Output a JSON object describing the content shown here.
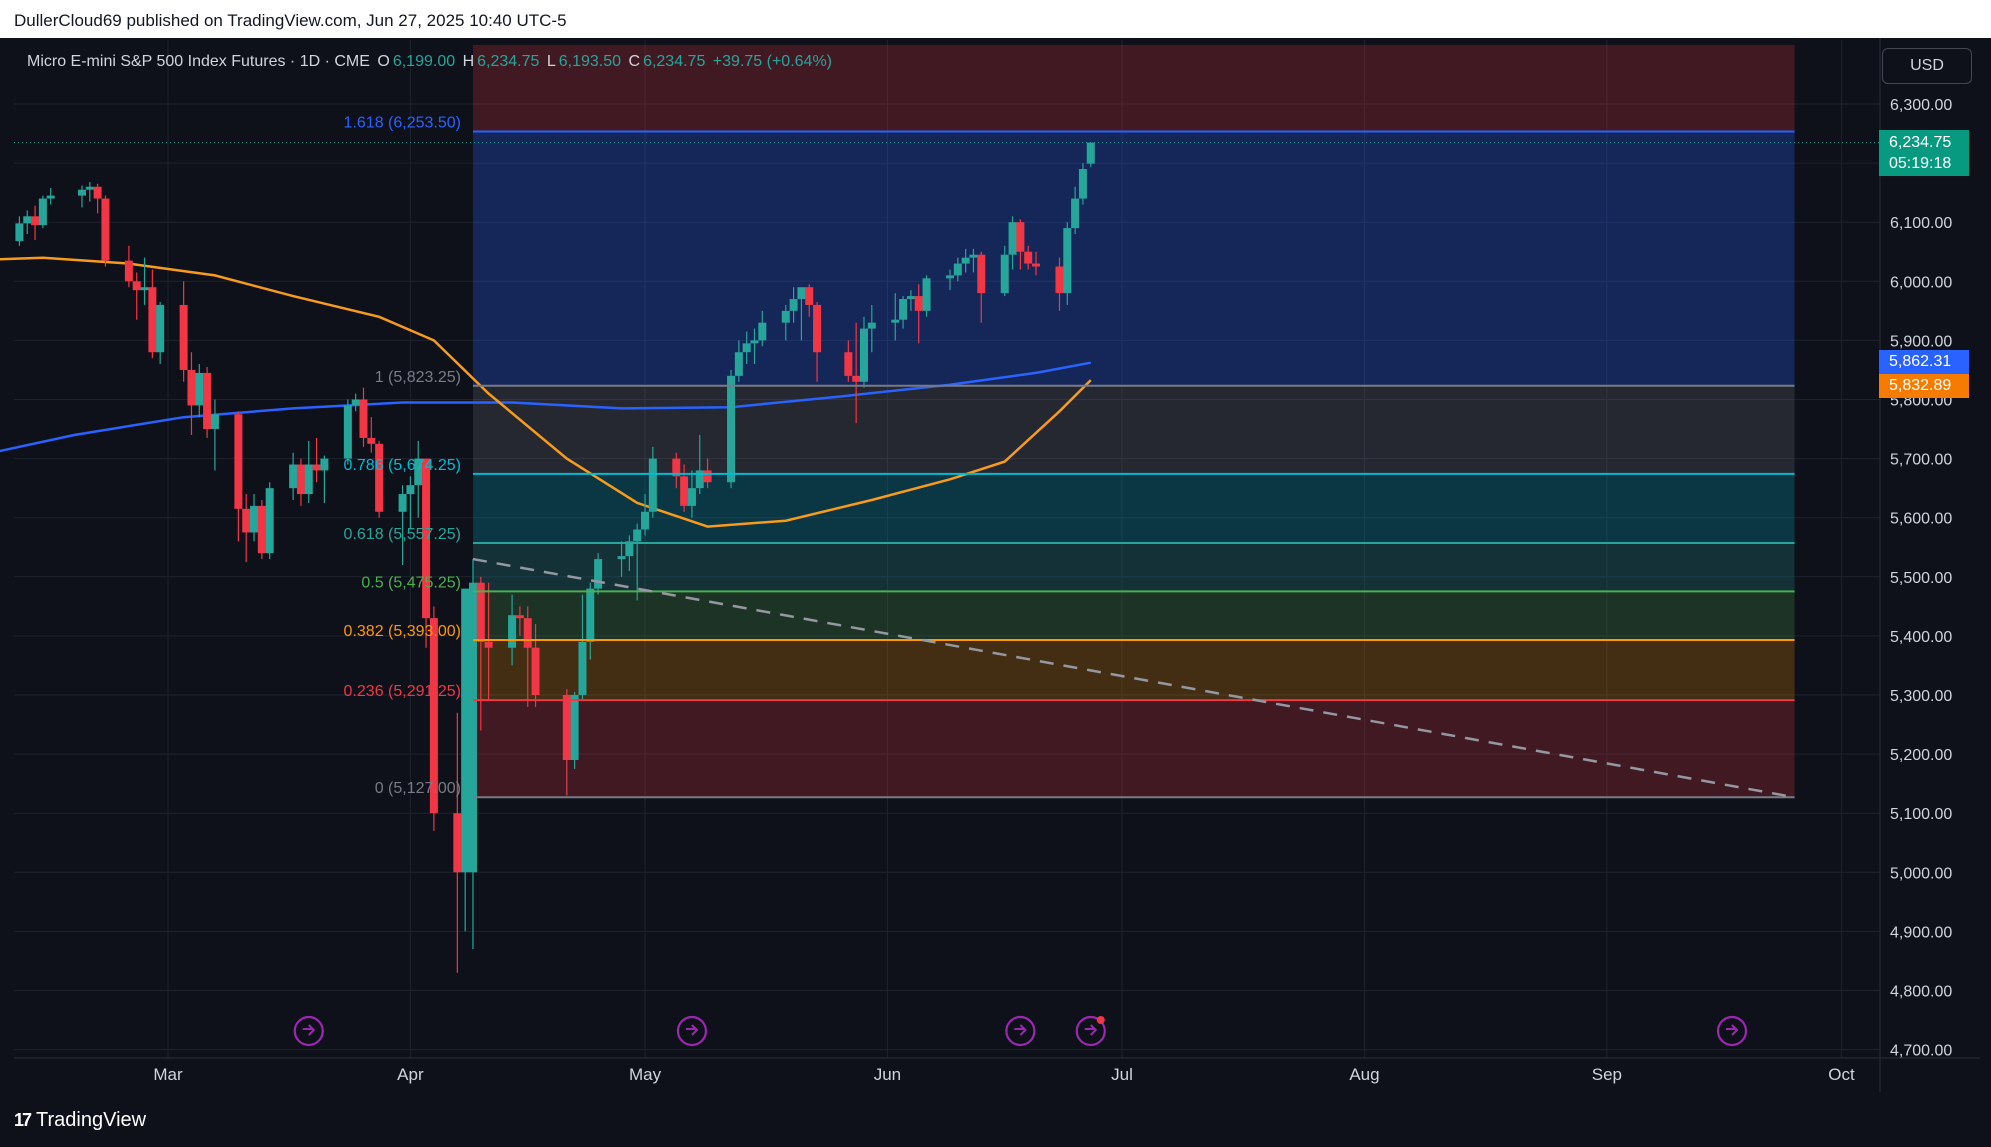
{
  "header": {
    "publisher": "DullerCloud69 published on TradingView.com, Jun 27, 2025 10:40 UTC-5"
  },
  "legend": {
    "symbol": "Micro E-mini S&P 500 Index Futures · 1D · CME",
    "o_label": "O",
    "o_value": "6,199.00",
    "h_label": "H",
    "h_value": "6,234.75",
    "l_label": "L",
    "l_value": "6,193.50",
    "c_label": "C",
    "c_value": "6,234.75",
    "change": "+39.75 (+0.64%)"
  },
  "currency": "USD",
  "price_tags": {
    "last_price": "6,234.75",
    "countdown": "05:19:18",
    "ma_blue": "5,862.31",
    "ma_orange": "5,832.89"
  },
  "footer": {
    "brand": "TradingView"
  },
  "colors": {
    "up": "#26a69a",
    "down": "#f23645",
    "ma_blue": "#2962ff",
    "ma_orange": "#f89b1c",
    "background": "#0f111a"
  },
  "chart_data": {
    "type": "candlestick",
    "ylim": [
      4650,
      6400
    ],
    "y_ticks": [
      "6,300.00",
      "6,200.00",
      "6,100.00",
      "6,000.00",
      "5,900.00",
      "5,800.00",
      "5,700.00",
      "5,600.00",
      "5,500.00",
      "5,400.00",
      "5,300.00",
      "5,200.00",
      "5,100.00",
      "5,000.00",
      "4,900.00",
      "4,800.00",
      "4,700.00"
    ],
    "x_ticks": [
      "Mar",
      "Apr",
      "May",
      "Jun",
      "Jul",
      "Aug",
      "Sep",
      "Oct"
    ],
    "x_tick_dates": [
      "2025-03-01",
      "2025-04-01",
      "2025-05-01",
      "2025-06-01",
      "2025-07-01",
      "2025-08-01",
      "2025-09-01",
      "2025-10-01"
    ],
    "fib_levels": [
      {
        "label": "1.618 (6,253.50)",
        "value": 6253.5,
        "color": "#2962ff"
      },
      {
        "label": "1 (5,823.25)",
        "value": 5823.25,
        "color": "#787b86"
      },
      {
        "label": "0.786 (5,674.25)",
        "value": 5674.25,
        "color": "#00bcd4"
      },
      {
        "label": "0.618 (5,557.25)",
        "value": 5557.25,
        "color": "#26a69a"
      },
      {
        "label": "0.5 (5,475.25)",
        "value": 5475.25,
        "color": "#4caf50"
      },
      {
        "label": "0.382 (5,393.00)",
        "value": 5393.0,
        "color": "#ff9800"
      },
      {
        "label": "0.236 (5,291.25)",
        "value": 5291.25,
        "color": "#f23645"
      },
      {
        "label": "0 (5,127.00)",
        "value": 5127.0,
        "color": "#787b86"
      }
    ],
    "fib_range_dates": [
      "2025-04-09",
      "2025-09-25"
    ],
    "fib_top_value": 6400,
    "trendline": {
      "from": {
        "date": "2025-04-09",
        "value": 5530
      },
      "to": {
        "date": "2025-09-25",
        "value": 5127
      }
    },
    "event_icon_dates": [
      "2025-03-19",
      "2025-05-07",
      "2025-06-18",
      "2025-06-27",
      "2025-09-17"
    ],
    "candles": [
      {
        "d": "2025-02-03",
        "o": 6060,
        "h": 6098,
        "l": 6040,
        "c": 6082
      },
      {
        "d": "2025-02-04",
        "o": 6082,
        "h": 6110,
        "l": 6070,
        "c": 6090
      },
      {
        "d": "2025-02-05",
        "o": 6090,
        "h": 6112,
        "l": 6065,
        "c": 6098
      },
      {
        "d": "2025-02-06",
        "o": 6098,
        "h": 6125,
        "l": 6090,
        "c": 6118
      },
      {
        "d": "2025-02-07",
        "o": 6118,
        "h": 6130,
        "l": 6060,
        "c": 6068
      },
      {
        "d": "2025-02-10",
        "o": 6068,
        "h": 6110,
        "l": 6060,
        "c": 6098
      },
      {
        "d": "2025-02-11",
        "o": 6098,
        "h": 6120,
        "l": 6080,
        "c": 6110
      },
      {
        "d": "2025-02-12",
        "o": 6110,
        "h": 6128,
        "l": 6070,
        "c": 6095
      },
      {
        "d": "2025-02-13",
        "o": 6095,
        "h": 6145,
        "l": 6090,
        "c": 6140
      },
      {
        "d": "2025-02-14",
        "o": 6140,
        "h": 6158,
        "l": 6130,
        "c": 6145
      },
      {
        "d": "2025-02-18",
        "o": 6145,
        "h": 6162,
        "l": 6125,
        "c": 6155
      },
      {
        "d": "2025-02-19",
        "o": 6155,
        "h": 6168,
        "l": 6135,
        "c": 6160
      },
      {
        "d": "2025-02-20",
        "o": 6160,
        "h": 6165,
        "l": 6115,
        "c": 6140
      },
      {
        "d": "2025-02-21",
        "o": 6140,
        "h": 6145,
        "l": 6025,
        "c": 6035
      },
      {
        "d": "2025-02-24",
        "o": 6035,
        "h": 6060,
        "l": 5990,
        "c": 6000
      },
      {
        "d": "2025-02-25",
        "o": 6000,
        "h": 6015,
        "l": 5935,
        "c": 5985
      },
      {
        "d": "2025-02-26",
        "o": 5985,
        "h": 6040,
        "l": 5960,
        "c": 5990
      },
      {
        "d": "2025-02-27",
        "o": 5990,
        "h": 6020,
        "l": 5870,
        "c": 5880
      },
      {
        "d": "2025-02-28",
        "o": 5880,
        "h": 5965,
        "l": 5860,
        "c": 5960
      },
      {
        "d": "2025-03-03",
        "o": 5960,
        "h": 6000,
        "l": 5830,
        "c": 5850
      },
      {
        "d": "2025-03-04",
        "o": 5850,
        "h": 5880,
        "l": 5740,
        "c": 5790
      },
      {
        "d": "2025-03-05",
        "o": 5790,
        "h": 5860,
        "l": 5770,
        "c": 5845
      },
      {
        "d": "2025-03-06",
        "o": 5845,
        "h": 5855,
        "l": 5735,
        "c": 5750
      },
      {
        "d": "2025-03-07",
        "o": 5750,
        "h": 5800,
        "l": 5680,
        "c": 5775
      },
      {
        "d": "2025-03-10",
        "o": 5775,
        "h": 5780,
        "l": 5560,
        "c": 5615
      },
      {
        "d": "2025-03-11",
        "o": 5615,
        "h": 5640,
        "l": 5525,
        "c": 5575
      },
      {
        "d": "2025-03-12",
        "o": 5575,
        "h": 5640,
        "l": 5560,
        "c": 5620
      },
      {
        "d": "2025-03-13",
        "o": 5620,
        "h": 5630,
        "l": 5530,
        "c": 5540
      },
      {
        "d": "2025-03-14",
        "o": 5540,
        "h": 5660,
        "l": 5530,
        "c": 5650
      },
      {
        "d": "2025-03-17",
        "o": 5650,
        "h": 5710,
        "l": 5630,
        "c": 5690
      },
      {
        "d": "2025-03-18",
        "o": 5690,
        "h": 5700,
        "l": 5620,
        "c": 5640
      },
      {
        "d": "2025-03-19",
        "o": 5640,
        "h": 5730,
        "l": 5625,
        "c": 5690
      },
      {
        "d": "2025-03-20",
        "o": 5690,
        "h": 5735,
        "l": 5660,
        "c": 5680
      },
      {
        "d": "2025-03-21",
        "o": 5680,
        "h": 5705,
        "l": 5625,
        "c": 5700
      },
      {
        "d": "2025-03-24",
        "o": 5700,
        "h": 5800,
        "l": 5690,
        "c": 5790
      },
      {
        "d": "2025-03-25",
        "o": 5790,
        "h": 5810,
        "l": 5780,
        "c": 5800
      },
      {
        "d": "2025-03-26",
        "o": 5800,
        "h": 5820,
        "l": 5720,
        "c": 5735
      },
      {
        "d": "2025-03-27",
        "o": 5735,
        "h": 5770,
        "l": 5710,
        "c": 5725
      },
      {
        "d": "2025-03-28",
        "o": 5725,
        "h": 5730,
        "l": 5600,
        "c": 5610
      },
      {
        "d": "2025-03-31",
        "o": 5610,
        "h": 5655,
        "l": 5520,
        "c": 5640
      },
      {
        "d": "2025-04-01",
        "o": 5640,
        "h": 5670,
        "l": 5580,
        "c": 5655
      },
      {
        "d": "2025-04-02",
        "o": 5655,
        "h": 5730,
        "l": 5600,
        "c": 5700
      },
      {
        "d": "2025-04-03",
        "o": 5700,
        "h": 5700,
        "l": 5380,
        "c": 5430
      },
      {
        "d": "2025-04-04",
        "o": 5430,
        "h": 5450,
        "l": 5070,
        "c": 5100
      },
      {
        "d": "2025-04-07",
        "o": 5100,
        "h": 5270,
        "l": 4830,
        "c": 5000
      },
      {
        "d": "2025-04-08",
        "o": 5000,
        "h": 5350,
        "l": 4900,
        "c": 5480
      },
      {
        "d": "2025-04-09",
        "o": 5000,
        "h": 5530,
        "l": 4870,
        "c": 5490
      },
      {
        "d": "2025-04-10",
        "o": 5490,
        "h": 5500,
        "l": 5240,
        "c": 5390
      },
      {
        "d": "2025-04-11",
        "o": 5390,
        "h": 5490,
        "l": 5290,
        "c": 5380
      },
      {
        "d": "2025-04-14",
        "o": 5380,
        "h": 5470,
        "l": 5350,
        "c": 5435
      },
      {
        "d": "2025-04-15",
        "o": 5435,
        "h": 5450,
        "l": 5400,
        "c": 5430
      },
      {
        "d": "2025-04-16",
        "o": 5430,
        "h": 5450,
        "l": 5280,
        "c": 5380
      },
      {
        "d": "2025-04-17",
        "o": 5380,
        "h": 5420,
        "l": 5280,
        "c": 5300
      },
      {
        "d": "2025-04-21",
        "o": 5300,
        "h": 5310,
        "l": 5130,
        "c": 5190
      },
      {
        "d": "2025-04-22",
        "o": 5190,
        "h": 5305,
        "l": 5175,
        "c": 5300
      },
      {
        "d": "2025-04-23",
        "o": 5300,
        "h": 5470,
        "l": 5290,
        "c": 5390
      },
      {
        "d": "2025-04-24",
        "o": 5390,
        "h": 5490,
        "l": 5360,
        "c": 5480
      },
      {
        "d": "2025-04-25",
        "o": 5480,
        "h": 5540,
        "l": 5470,
        "c": 5530
      },
      {
        "d": "2025-04-28",
        "o": 5530,
        "h": 5560,
        "l": 5500,
        "c": 5535
      },
      {
        "d": "2025-04-29",
        "o": 5535,
        "h": 5570,
        "l": 5510,
        "c": 5560
      },
      {
        "d": "2025-04-30",
        "o": 5560,
        "h": 5590,
        "l": 5460,
        "c": 5580
      },
      {
        "d": "2025-05-01",
        "o": 5580,
        "h": 5640,
        "l": 5570,
        "c": 5610
      },
      {
        "d": "2025-05-02",
        "o": 5610,
        "h": 5720,
        "l": 5600,
        "c": 5700
      },
      {
        "d": "2025-05-05",
        "o": 5700,
        "h": 5710,
        "l": 5650,
        "c": 5670
      },
      {
        "d": "2025-05-06",
        "o": 5670,
        "h": 5690,
        "l": 5610,
        "c": 5620
      },
      {
        "d": "2025-05-07",
        "o": 5620,
        "h": 5680,
        "l": 5600,
        "c": 5650
      },
      {
        "d": "2025-05-08",
        "o": 5650,
        "h": 5740,
        "l": 5640,
        "c": 5680
      },
      {
        "d": "2025-05-09",
        "o": 5680,
        "h": 5700,
        "l": 5650,
        "c": 5660
      },
      {
        "d": "2025-05-12",
        "o": 5660,
        "h": 5850,
        "l": 5650,
        "c": 5840
      },
      {
        "d": "2025-05-13",
        "o": 5840,
        "h": 5900,
        "l": 5830,
        "c": 5880
      },
      {
        "d": "2025-05-14",
        "o": 5880,
        "h": 5915,
        "l": 5860,
        "c": 5895
      },
      {
        "d": "2025-05-15",
        "o": 5895,
        "h": 5920,
        "l": 5860,
        "c": 5900
      },
      {
        "d": "2025-05-16",
        "o": 5900,
        "h": 5950,
        "l": 5890,
        "c": 5930
      },
      {
        "d": "2025-05-19",
        "o": 5930,
        "h": 5960,
        "l": 5900,
        "c": 5950
      },
      {
        "d": "2025-05-20",
        "o": 5950,
        "h": 5990,
        "l": 5930,
        "c": 5970
      },
      {
        "d": "2025-05-21",
        "o": 5970,
        "h": 5985,
        "l": 5900,
        "c": 5990
      },
      {
        "d": "2025-05-22",
        "o": 5990,
        "h": 5995,
        "l": 5940,
        "c": 5960
      },
      {
        "d": "2025-05-23",
        "o": 5960,
        "h": 5965,
        "l": 5830,
        "c": 5880
      },
      {
        "d": "2025-05-27",
        "o": 5880,
        "h": 5900,
        "l": 5830,
        "c": 5840
      },
      {
        "d": "2025-05-28",
        "o": 5840,
        "h": 5930,
        "l": 5760,
        "c": 5830
      },
      {
        "d": "2025-05-29",
        "o": 5830,
        "h": 5940,
        "l": 5820,
        "c": 5920
      },
      {
        "d": "2025-05-30",
        "o": 5920,
        "h": 5960,
        "l": 5880,
        "c": 5930
      },
      {
        "d": "2025-06-02",
        "o": 5930,
        "h": 5980,
        "l": 5900,
        "c": 5935
      },
      {
        "d": "2025-06-03",
        "o": 5935,
        "h": 5975,
        "l": 5920,
        "c": 5970
      },
      {
        "d": "2025-06-04",
        "o": 5970,
        "h": 5985,
        "l": 5950,
        "c": 5975
      },
      {
        "d": "2025-06-05",
        "o": 5975,
        "h": 5995,
        "l": 5895,
        "c": 5950
      },
      {
        "d": "2025-06-06",
        "o": 5950,
        "h": 6010,
        "l": 5940,
        "c": 6005
      },
      {
        "d": "2025-06-09",
        "o": 6005,
        "h": 6020,
        "l": 5985,
        "c": 6010
      },
      {
        "d": "2025-06-10",
        "o": 6010,
        "h": 6040,
        "l": 6000,
        "c": 6030
      },
      {
        "d": "2025-06-11",
        "o": 6030,
        "h": 6055,
        "l": 6015,
        "c": 6040
      },
      {
        "d": "2025-06-12",
        "o": 6040,
        "h": 6055,
        "l": 6015,
        "c": 6045
      },
      {
        "d": "2025-06-13",
        "o": 6045,
        "h": 6050,
        "l": 5930,
        "c": 5980
      },
      {
        "d": "2025-06-16",
        "o": 5980,
        "h": 6060,
        "l": 5975,
        "c": 6045
      },
      {
        "d": "2025-06-17",
        "o": 6045,
        "h": 6110,
        "l": 6020,
        "c": 6100
      },
      {
        "d": "2025-06-18",
        "o": 6100,
        "h": 6105,
        "l": 6020,
        "c": 6050
      },
      {
        "d": "2025-06-19",
        "o": 6050,
        "h": 6060,
        "l": 6020,
        "c": 6030
      },
      {
        "d": "2025-06-20",
        "o": 6030,
        "h": 6050,
        "l": 6010,
        "c": 6025
      },
      {
        "d": "2025-06-23",
        "o": 6025,
        "h": 6040,
        "l": 5950,
        "c": 5980
      },
      {
        "d": "2025-06-24",
        "o": 5980,
        "h": 6100,
        "l": 5960,
        "c": 6090
      },
      {
        "d": "2025-06-25",
        "o": 6090,
        "h": 6160,
        "l": 6080,
        "c": 6140
      },
      {
        "d": "2025-06-26",
        "o": 6140,
        "h": 6200,
        "l": 6130,
        "c": 6190
      },
      {
        "d": "2025-06-27",
        "o": 6199,
        "h": 6234.75,
        "l": 6193.5,
        "c": 6234.75
      }
    ],
    "ma_blue_points": [
      {
        "d": "2025-02-03",
        "v": 5700
      },
      {
        "d": "2025-02-17",
        "v": 5740
      },
      {
        "d": "2025-03-03",
        "v": 5770
      },
      {
        "d": "2025-03-17",
        "v": 5785
      },
      {
        "d": "2025-03-31",
        "v": 5795
      },
      {
        "d": "2025-04-14",
        "v": 5795
      },
      {
        "d": "2025-04-28",
        "v": 5785
      },
      {
        "d": "2025-05-12",
        "v": 5787
      },
      {
        "d": "2025-05-26",
        "v": 5805
      },
      {
        "d": "2025-06-09",
        "v": 5825
      },
      {
        "d": "2025-06-20",
        "v": 5845
      },
      {
        "d": "2025-06-27",
        "v": 5862.31
      }
    ],
    "ma_orange_points": [
      {
        "d": "2025-02-03",
        "v": 6035
      },
      {
        "d": "2025-02-13",
        "v": 6040
      },
      {
        "d": "2025-02-24",
        "v": 6030
      },
      {
        "d": "2025-03-07",
        "v": 6010
      },
      {
        "d": "2025-03-17",
        "v": 5975
      },
      {
        "d": "2025-03-28",
        "v": 5940
      },
      {
        "d": "2025-04-04",
        "v": 5900
      },
      {
        "d": "2025-04-11",
        "v": 5810
      },
      {
        "d": "2025-04-21",
        "v": 5700
      },
      {
        "d": "2025-04-30",
        "v": 5625
      },
      {
        "d": "2025-05-09",
        "v": 5585
      },
      {
        "d": "2025-05-19",
        "v": 5595
      },
      {
        "d": "2025-05-30",
        "v": 5630
      },
      {
        "d": "2025-06-09",
        "v": 5665
      },
      {
        "d": "2025-06-16",
        "v": 5695
      },
      {
        "d": "2025-06-23",
        "v": 5780
      },
      {
        "d": "2025-06-27",
        "v": 5832.89
      }
    ]
  }
}
